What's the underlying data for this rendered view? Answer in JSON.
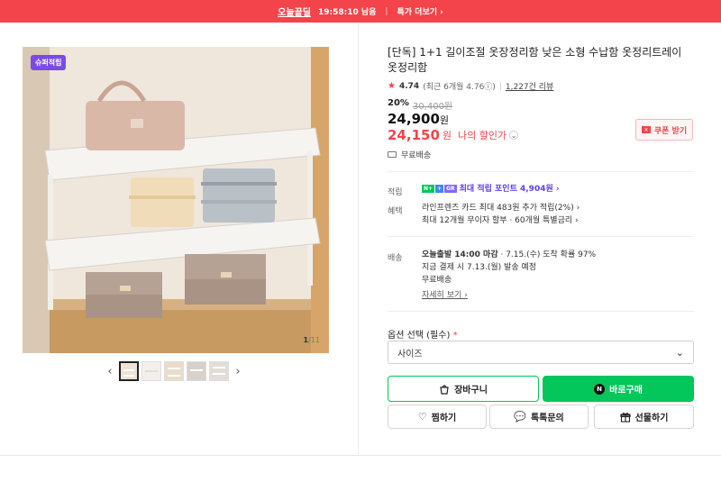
{
  "topbar": {
    "deal_label": "오늘끝딜",
    "timer": "19:58:10 남음",
    "more_label": "특가 더보기 ›"
  },
  "gallery": {
    "badge": "슈퍼적립",
    "counter_current": "1",
    "counter_total": "/11",
    "prev_arrow": "‹",
    "next_arrow": "›"
  },
  "product": {
    "title": "[단독] 1+1 길이조절 옷장정리함 낮은 소형 수납함 옷정리트레이 옷정리함",
    "rating": {
      "score": "4.74",
      "recent": "(최근 6개월 4.76ⓘ)",
      "reviews": "1,227건 리뷰"
    },
    "discount_pct": "20%",
    "original_price": "30,400원",
    "price_value": "24,900",
    "price_unit": "원",
    "my_price_value": "24,150",
    "my_price_unit": "원",
    "my_price_label": "나의 할인가",
    "coupon_label": "쿠폰 받기",
    "shipping_free": "무료배송"
  },
  "benefits": {
    "points_label": "적립",
    "points_text": "최대 적립 포인트 4,904원 ›",
    "card_label": "혜택",
    "card_lines": [
      "라인프렌즈 카드 최대 483원 추가 적립(2%) ›",
      "최대 12개월 무이자 할부 · 60개월 특별금리 ›"
    ]
  },
  "delivery": {
    "label": "배송",
    "line1_bold": "오늘출발 14:00 마감",
    "line1_rest": " · 7.15.(수) 도착 확률 97%",
    "line2": "지금 결제 시 7.13.(월) 발송 예정",
    "line3": "무료배송",
    "detail_link": "자세히 보기 ›"
  },
  "options": {
    "label": "옵션 선택 (필수)",
    "required_mark": "*",
    "select_value": "사이즈"
  },
  "actions": {
    "cart": "장바구니",
    "buy": "바로구매",
    "wish": "찜하기",
    "talk": "톡톡문의",
    "gift": "선물하기"
  },
  "colors": {
    "accent_red": "#f2444a",
    "naver_green": "#03c75a",
    "badge_purple": "#7b4ae6"
  }
}
